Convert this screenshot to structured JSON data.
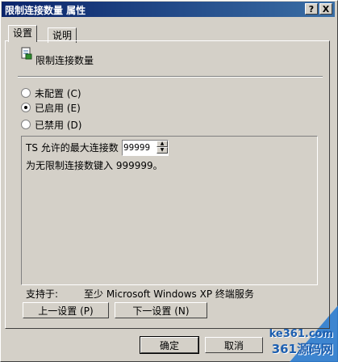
{
  "window": {
    "title": "限制连接数量 属性",
    "help_button": "?",
    "close_button": "X"
  },
  "tabs": [
    {
      "label": "设置"
    },
    {
      "label": "说明"
    }
  ],
  "policy": {
    "title": "限制连接数量"
  },
  "radios": [
    {
      "label": "未配置 (C)",
      "checked": false
    },
    {
      "label": "已启用 (E)",
      "checked": true
    },
    {
      "label": "已禁用 (D)",
      "checked": false
    }
  ],
  "options": {
    "max_label": "TS 允许的最大连接数",
    "max_value": "99999",
    "hint": "为无限制连接数键入 999999。"
  },
  "support": {
    "label": "支持于:",
    "value": "至少 Microsoft Windows XP 终端服务"
  },
  "nav": {
    "prev": "上一设置 (P)",
    "next": "下一设置 (N)"
  },
  "footer": {
    "ok": "确定",
    "cancel": "取消"
  },
  "watermark": {
    "site": "ke361.com",
    "brand": "361源码网"
  }
}
